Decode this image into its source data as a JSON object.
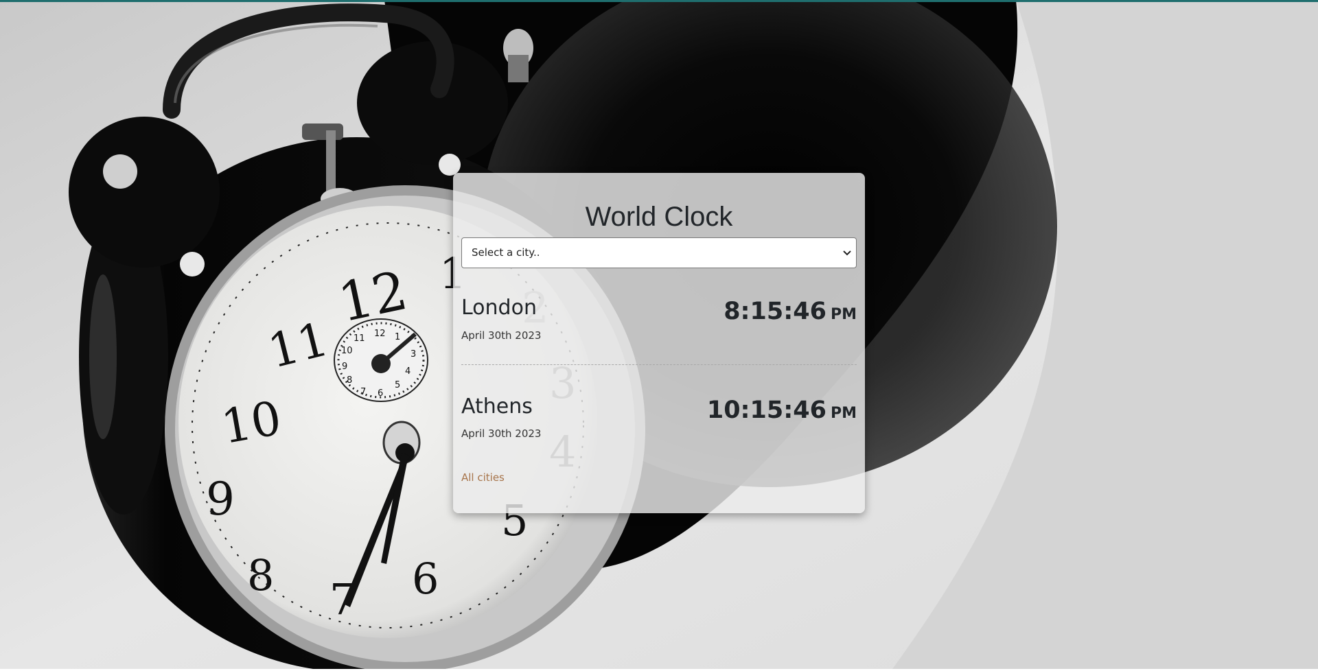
{
  "app": {
    "title": "World Clock"
  },
  "search": {
    "selected_value": "Select a city.."
  },
  "cities": [
    {
      "name": "London",
      "date": "April 30th 2023",
      "time": "8:15:46",
      "ampm": "PM"
    },
    {
      "name": "Athens",
      "date": "April 30th 2023",
      "time": "10:15:46",
      "ampm": "PM"
    }
  ],
  "links": {
    "all_cities": "All cities"
  },
  "colors": {
    "accent_top": "#1f6e6e",
    "link": "#a7744a",
    "card_bg": "rgba(235,235,235,0.82)"
  },
  "icons": {
    "select": "chevron-down-icon",
    "background": "alarm-clock-photo"
  }
}
